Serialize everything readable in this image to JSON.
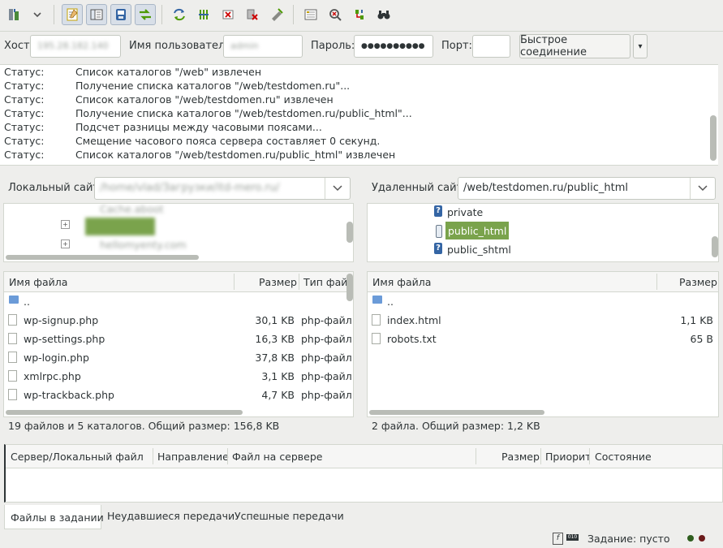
{
  "quickconnect": {
    "host_label": "Хост:",
    "host_value": "195.28.182.140",
    "user_label": "Имя пользователя",
    "user_value": "admin",
    "pass_label": "Пароль:",
    "pass_value": "●●●●●●●●●●",
    "port_label": "Порт:",
    "port_value": "",
    "connect_label": "Быстрое соединение",
    "dropdown_arrow": "▾"
  },
  "log": [
    {
      "key": "Статус:",
      "msg": "Список каталогов \"/web\" извлечен"
    },
    {
      "key": "Статус:",
      "msg": "Получение списка каталогов \"/web/testdomen.ru\"..."
    },
    {
      "key": "Статус:",
      "msg": "Список каталогов \"/web/testdomen.ru\" извлечен"
    },
    {
      "key": "Статус:",
      "msg": "Получение списка каталогов \"/web/testdomen.ru/public_html\"..."
    },
    {
      "key": "Статус:",
      "msg": "Подсчет разницы между часовыми поясами..."
    },
    {
      "key": "Статус:",
      "msg": "Смещение часового пояса сервера составляет 0 секунд."
    },
    {
      "key": "Статус:",
      "msg": "Список каталогов \"/web/testdomen.ru/public_html\" извлечен"
    }
  ],
  "local": {
    "label": "Локальный сайт:",
    "path": "/home/vlad/Загрузки/itd-mero.ru/",
    "tree": [
      {
        "name": "Cache.aboot",
        "expander": ""
      },
      {
        "name": "testdomen",
        "expander": "+"
      },
      {
        "name": "hellomyenty.com",
        "expander": "+"
      }
    ],
    "columns": {
      "name": "Имя файла",
      "size": "Размер",
      "type": "Тип фай"
    },
    "files": [
      {
        "name": "..",
        "size": "",
        "type": "",
        "kind": "up"
      },
      {
        "name": "wp-signup.php",
        "size": "30,1 KB",
        "type": "php-файл",
        "kind": "file"
      },
      {
        "name": "wp-settings.php",
        "size": "16,3 KB",
        "type": "php-файл",
        "kind": "file"
      },
      {
        "name": "wp-login.php",
        "size": "37,8 KB",
        "type": "php-файл",
        "kind": "file"
      },
      {
        "name": "xmlrpc.php",
        "size": "3,1 KB",
        "type": "php-файл",
        "kind": "file"
      },
      {
        "name": "wp-trackback.php",
        "size": "4,7 KB",
        "type": "php-файл",
        "kind": "file"
      }
    ],
    "status": "19 файлов и 5 каталогов. Общий размер: 156,8 KB"
  },
  "remote": {
    "label": "Удаленный сайт:",
    "path": "/web/testdomen.ru/public_html",
    "tree": [
      {
        "name": "private",
        "selected": false,
        "icon": "question"
      },
      {
        "name": "public_html",
        "selected": true,
        "icon": "folder-open"
      },
      {
        "name": "public_shtml",
        "selected": false,
        "icon": "question"
      }
    ],
    "columns": {
      "name": "Имя файла",
      "size": "Размер"
    },
    "files": [
      {
        "name": "..",
        "size": "",
        "kind": "up"
      },
      {
        "name": "index.html",
        "size": "1,1 KB",
        "kind": "file"
      },
      {
        "name": "robots.txt",
        "size": "65 B",
        "kind": "file"
      }
    ],
    "status": "2 файла. Общий размер: 1,2 KB"
  },
  "queue": {
    "columns": {
      "server_local": "Сервер/Локальный файл",
      "direction": "Направление",
      "remote_file": "Файл на сервере",
      "size": "Размер",
      "priority": "Приорите",
      "state": "Состояние"
    },
    "tabs": [
      "Файлы в задании",
      "Неудавшиеся передачи",
      "Успешные передачи"
    ],
    "active_tab": 0
  },
  "statusbar": {
    "queue_text": "Задание: пусто"
  },
  "colors": {
    "selection": "#7aa34c",
    "panel_bg": "#ffffff",
    "window_bg": "#eeeeec"
  }
}
